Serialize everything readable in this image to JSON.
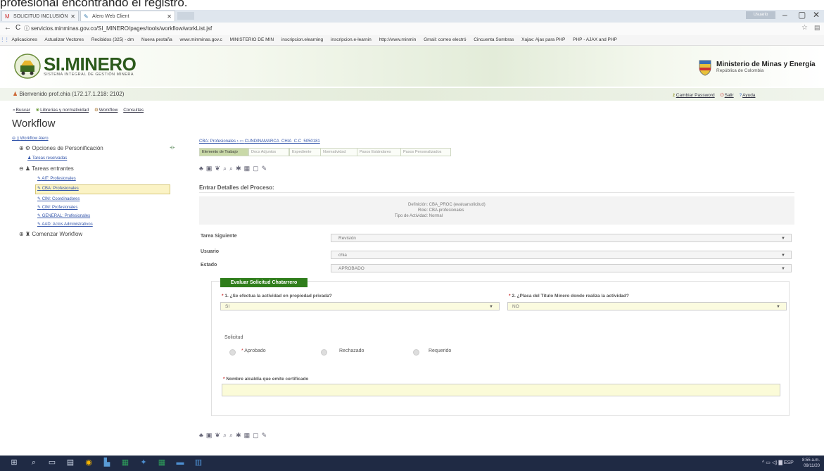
{
  "caption": "profesional encontrando el registro.",
  "browser": {
    "tabs": [
      {
        "label": "SOLICITUD INCLUSIÓN"
      },
      {
        "label": "Alero Web Client"
      }
    ],
    "profile_btn": "Usuario",
    "url": "servicios.minminas.gov.co/SI_MINERO/pages/tools/workflow/workList.jsf",
    "bookmarks": [
      "Aplicaciones",
      "Actualizar Vectores",
      "Recibidos (325) - dm",
      "Nueva pestaña",
      "www.minminas.gov.c",
      "MINISTERIO DE MIN",
      "inscripcion.elearning",
      "inscripcion.e-learnin",
      "http://www.minmin",
      "Gmail: correo electró",
      "Cincuenta Sombras",
      "Xajax: Ajax para PHP",
      "PHP - AJAX and PHP"
    ]
  },
  "header": {
    "logo_title": "SI.MINERO",
    "logo_subtitle": "SISTEMA INTEGRAL DE GESTIÓN MINERA",
    "ministry": "Ministerio de Minas y Energía",
    "ministry_sub": "República de Colombia"
  },
  "welcome": "Bienvenido prof.chia (172.17.1.218: 2102)",
  "toplinks": [
    "Cambiar Password",
    "Salir",
    "Ayuda"
  ],
  "menu": [
    "Buscar",
    "Librerias y normatividad",
    "Workflow",
    "Consultas"
  ],
  "workflow_title": "Workflow",
  "tree": {
    "root": "Workflow Alero",
    "personalizacion": "Opciones de Personificación",
    "tareas_reservadas": "Tareas reservadas",
    "tareas_entrantes": "Tareas entrantes",
    "items": [
      "AIT: Profesionales",
      "CBA: Profesionales",
      "CIM: Coordinadores",
      "CIM: Profesionales",
      "GENERAL: Profesionales",
      "AAD: Actos Administrativos"
    ],
    "comenzar": "Comenzar Workflow"
  },
  "breadcrumb": [
    "CBA: Profesionales",
    "CUNDINAMARCA_CHIA_C.C_5050181"
  ],
  "subtabs": [
    "Elemento de Trabajo",
    "Docs Adjuntos",
    "Expediente",
    "Normatividad",
    "Pasos Estándares",
    "Pasos Personalizados"
  ],
  "panel_title": "Entrar Detalles del Proceso:",
  "details": {
    "definicion_label": "Definición:",
    "definicion": "CBA_PROC (evaluarsolicitud)",
    "role_label": "Role:",
    "role": "CBA.profesionales",
    "tipo_label": "Tipo de Actividad:",
    "tipo": "Normal"
  },
  "fields": {
    "tarea_label": "Tarea Siguiente",
    "tarea_value": "Revisión",
    "usuario_label": "Usuario",
    "usuario_value": "chia",
    "estado_label": "Estado",
    "estado_value": "APROBADO"
  },
  "form": {
    "tab": "Evaluar Solicitud Chatarrero",
    "q1": "1. ¿Se efectua la actividad en propiedad privada?",
    "q1_value": "SI",
    "q2": "2. ¿Placa del Título Minero donde realiza la actividad?",
    "q2_value": "NO",
    "solicitud_label": "Solicitud",
    "options": [
      "Aprobado",
      "Rechazado",
      "Requerido"
    ],
    "nombre_label": "Nombre alcaldía que emite certificado",
    "nombre_value": ""
  },
  "taskbar": {
    "lang": "ESP",
    "time": "8:55 a.m.",
    "date": "09/11/20"
  }
}
